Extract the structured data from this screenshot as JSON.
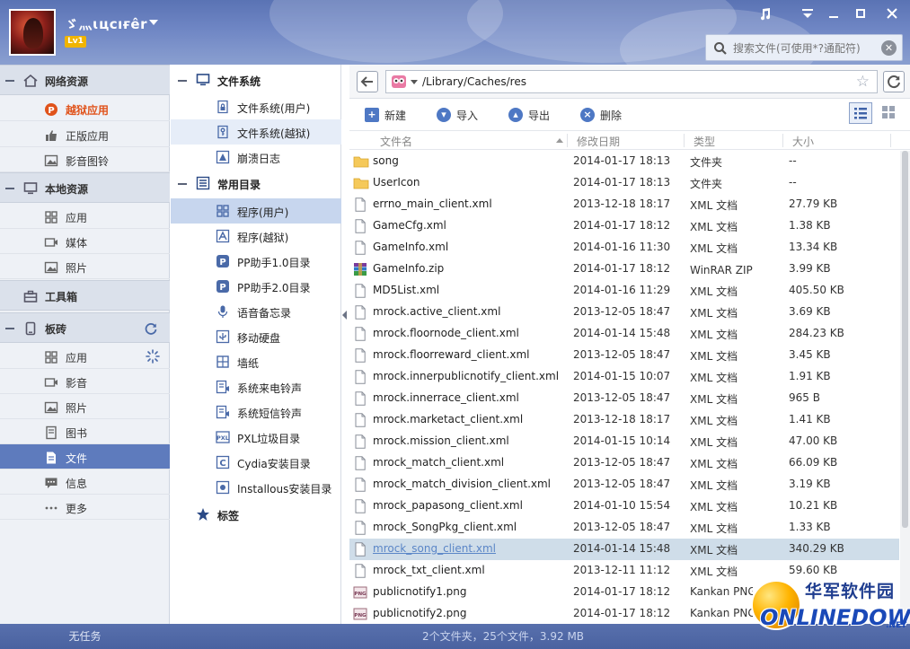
{
  "user": {
    "name": "ゞ灬ɩцсıғêr",
    "level": "Lv1"
  },
  "search": {
    "placeholder": "搜索文件(可使用*?通配符)"
  },
  "nav": {
    "sections": [
      {
        "label": "网络资源"
      },
      {
        "label": "本地资源"
      },
      {
        "label": "工具箱"
      },
      {
        "label": "板砖"
      }
    ],
    "items": [
      {
        "label": "越狱应用"
      },
      {
        "label": "正版应用"
      },
      {
        "label": "影音图铃"
      },
      {
        "label": "应用"
      },
      {
        "label": "媒体"
      },
      {
        "label": "照片"
      },
      {
        "label": "应用"
      },
      {
        "label": "影音"
      },
      {
        "label": "照片"
      },
      {
        "label": "图书"
      },
      {
        "label": "文件"
      },
      {
        "label": "信息"
      },
      {
        "label": "更多"
      }
    ]
  },
  "tree": {
    "headers": [
      {
        "label": "文件系统"
      },
      {
        "label": "常用目录"
      },
      {
        "label": "标签"
      }
    ],
    "items": [
      {
        "label": "文件系统(用户)"
      },
      {
        "label": "文件系统(越狱)"
      },
      {
        "label": "崩溃日志"
      },
      {
        "label": "程序(用户)"
      },
      {
        "label": "程序(越狱)"
      },
      {
        "label": "PP助手1.0目录"
      },
      {
        "label": "PP助手2.0目录"
      },
      {
        "label": "语音备忘录"
      },
      {
        "label": "移动硬盘"
      },
      {
        "label": "墙纸"
      },
      {
        "label": "系统来电铃声"
      },
      {
        "label": "系统短信铃声"
      },
      {
        "label": "PXL垃圾目录"
      },
      {
        "label": "Cydia安装目录"
      },
      {
        "label": "Installous安装目录"
      }
    ]
  },
  "address": {
    "path": "/Library/Caches/res"
  },
  "toolbar": {
    "new": "新建",
    "import": "导入",
    "export": "导出",
    "delete": "删除"
  },
  "columns": {
    "name": "文件名",
    "date": "修改日期",
    "type": "类型",
    "size": "大小"
  },
  "files": [
    {
      "name": "song",
      "date": "2014-01-17 18:13",
      "type": "文件夹",
      "size": "--",
      "kind": "folder"
    },
    {
      "name": "UserIcon",
      "date": "2014-01-17 18:13",
      "type": "文件夹",
      "size": "--",
      "kind": "folder"
    },
    {
      "name": "errno_main_client.xml",
      "date": "2013-12-18 18:17",
      "type": "XML 文档",
      "size": "27.79 KB",
      "kind": "doc"
    },
    {
      "name": "GameCfg.xml",
      "date": "2014-01-17 18:12",
      "type": "XML 文档",
      "size": "1.38 KB",
      "kind": "doc"
    },
    {
      "name": "GameInfo.xml",
      "date": "2014-01-16 11:30",
      "type": "XML 文档",
      "size": "13.34 KB",
      "kind": "doc"
    },
    {
      "name": "GameInfo.zip",
      "date": "2014-01-17 18:12",
      "type": "WinRAR ZIP 压...",
      "size": "3.99 KB",
      "kind": "zip"
    },
    {
      "name": "MD5List.xml",
      "date": "2014-01-16 11:29",
      "type": "XML 文档",
      "size": "405.50 KB",
      "kind": "doc"
    },
    {
      "name": "mrock.active_client.xml",
      "date": "2013-12-05 18:47",
      "type": "XML 文档",
      "size": "3.69 KB",
      "kind": "doc"
    },
    {
      "name": "mrock.floornode_client.xml",
      "date": "2014-01-14 15:48",
      "type": "XML 文档",
      "size": "284.23 KB",
      "kind": "doc"
    },
    {
      "name": "mrock.floorreward_client.xml",
      "date": "2013-12-05 18:47",
      "type": "XML 文档",
      "size": "3.45 KB",
      "kind": "doc"
    },
    {
      "name": "mrock.innerpublicnotify_client.xml",
      "date": "2014-01-15 10:07",
      "type": "XML 文档",
      "size": "1.91 KB",
      "kind": "doc"
    },
    {
      "name": "mrock.innerrace_client.xml",
      "date": "2013-12-05 18:47",
      "type": "XML 文档",
      "size": "965 B",
      "kind": "doc"
    },
    {
      "name": "mrock.marketact_client.xml",
      "date": "2013-12-18 18:17",
      "type": "XML 文档",
      "size": "1.41 KB",
      "kind": "doc"
    },
    {
      "name": "mrock.mission_client.xml",
      "date": "2014-01-15 10:14",
      "type": "XML 文档",
      "size": "47.00 KB",
      "kind": "doc"
    },
    {
      "name": "mrock_match_client.xml",
      "date": "2013-12-05 18:47",
      "type": "XML 文档",
      "size": "66.09 KB",
      "kind": "doc"
    },
    {
      "name": "mrock_match_division_client.xml",
      "date": "2013-12-05 18:47",
      "type": "XML 文档",
      "size": "3.19 KB",
      "kind": "doc"
    },
    {
      "name": "mrock_papasong_client.xml",
      "date": "2014-01-10 15:54",
      "type": "XML 文档",
      "size": "10.21 KB",
      "kind": "doc"
    },
    {
      "name": "mrock_SongPkg_client.xml",
      "date": "2013-12-05 18:47",
      "type": "XML 文档",
      "size": "1.33 KB",
      "kind": "doc"
    },
    {
      "name": "mrock_song_client.xml",
      "date": "2014-01-14 15:48",
      "type": "XML 文档",
      "size": "340.29 KB",
      "kind": "doc",
      "selected": true
    },
    {
      "name": "mrock_txt_client.xml",
      "date": "2013-12-11 11:12",
      "type": "XML 文档",
      "size": "59.60 KB",
      "kind": "doc"
    },
    {
      "name": "publicnotify1.png",
      "date": "2014-01-17 18:12",
      "type": "Kankan PNG",
      "size": "",
      "kind": "png"
    },
    {
      "name": "publicnotify2.png",
      "date": "2014-01-17 18:12",
      "type": "Kankan PNG",
      "size": "",
      "kind": "png"
    }
  ],
  "status": {
    "left": "无任务",
    "summary": "2个文件夹，25个文件，3.92 MB"
  },
  "watermark": {
    "cn": "华军软件园",
    "en": "ONLINEDOWN",
    "net": ".NET"
  },
  "colors": {
    "accent": "#5e7bbd",
    "header": "#6f86c4",
    "selection": "#cfdde9"
  }
}
